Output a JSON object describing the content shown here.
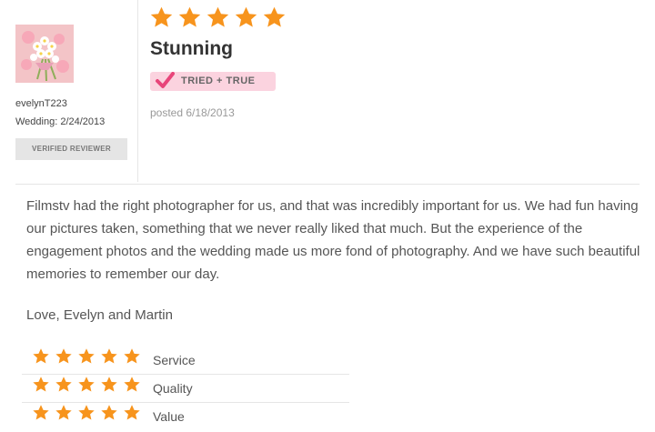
{
  "reviewer": {
    "name": "evelynT223",
    "wedding_line": "Wedding: 2/24/2013",
    "verified_label": "VERIFIED REVIEWER"
  },
  "review": {
    "overall_rating": 5,
    "max_rating": 5,
    "title": "Stunning",
    "badge_label": "TRIED + TRUE",
    "posted": "posted 6/18/2013",
    "body": "Filmstv had the right photographer for us, and that was incredibly important for us. We had fun having our pictures taken, something that we never really liked that much. But the experience of the engagement photos and the wedding made us more fond of photography. And we have such beautiful memories to remember our day.",
    "signoff": "Love, Evelyn and Martin"
  },
  "ratings": [
    {
      "label": "Service",
      "value": 5
    },
    {
      "label": "Quality",
      "value": 5
    },
    {
      "label": "Value",
      "value": 5
    }
  ],
  "colors": {
    "star": "#f7941d",
    "badge_bg": "#fbd3df",
    "badge_check": "#e8457a"
  },
  "icons": {
    "star": "star-icon",
    "check": "check-icon",
    "avatar": "bouquet-avatar"
  }
}
